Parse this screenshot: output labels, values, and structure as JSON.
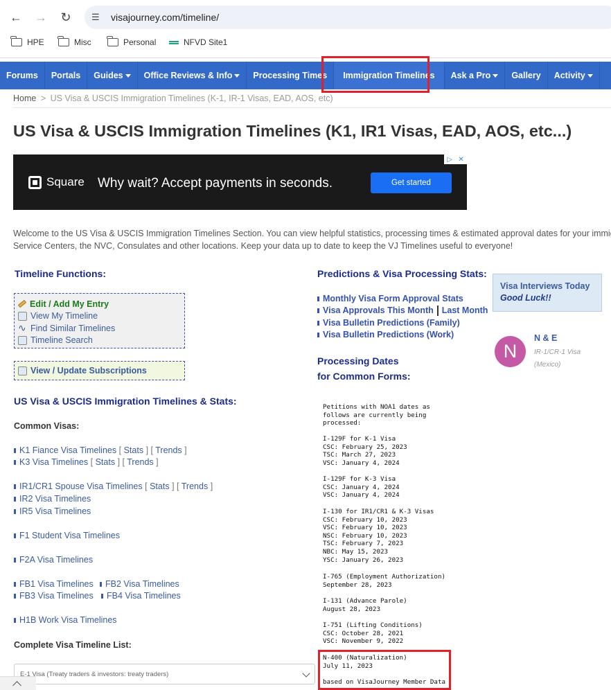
{
  "browser": {
    "url": "visajourney.com/timeline/",
    "bookmarks": [
      "HPE",
      "Misc",
      "Personal",
      "NFVD Site1"
    ]
  },
  "nav": {
    "items": [
      {
        "label": "Forums",
        "dropdown": false
      },
      {
        "label": "Portals",
        "dropdown": false
      },
      {
        "label": "Guides",
        "dropdown": true
      },
      {
        "label": "Office Reviews & Info",
        "dropdown": true
      },
      {
        "label": "Processing Times",
        "dropdown": false
      },
      {
        "label": "Immigration Timelines",
        "dropdown": false,
        "active": true
      },
      {
        "label": "Ask a Pro",
        "dropdown": true
      },
      {
        "label": "Gallery",
        "dropdown": false
      },
      {
        "label": "Activity",
        "dropdown": true
      }
    ],
    "color": "#3369c9",
    "highlight_color": "#e0202a"
  },
  "breadcrumb": {
    "home": "Home",
    "sep": ">",
    "current": "US Visa & USCIS Immigration Timelines (K-1, IR-1 Visas, EAD, AOS, etc)"
  },
  "page_title": "US Visa & USCIS Immigration Timelines (K1, IR1 Visas, EAD, AOS, etc...)",
  "ad": {
    "brand": "Square",
    "tagline": "Why wait? Accept payments in seconds.",
    "cta": "Get started"
  },
  "intro": [
    "Welcome to the US Visa & USCIS Immigration Timelines Section. You can view helpful statistics, processing times & estimated approval dates for your immigr",
    "Service Centers, the NVC, Consulates and other locations. Keep your data up to date to keep the VJ Timelines useful to everyone!"
  ],
  "timeline_functions": {
    "heading": "Timeline Functions:",
    "items": [
      "Edit / Add My Entry",
      "View My Timeline",
      "Find Similar Timelines",
      "Timeline Search"
    ],
    "subscriptions": "View / Update Subscriptions"
  },
  "stats_section": {
    "heading": "US Visa & USCIS Immigration Timelines & Stats:",
    "common_visas_label": "Common Visas:",
    "stats": "Stats",
    "trends": "Trends",
    "links": {
      "k1": "K1 Fiance Visa Timelines",
      "k3": "K3 Visa Timelines",
      "ir1": "IR1/CR1 Spouse Visa Timelines",
      "ir2": "IR2 Visa Timelines",
      "ir5": "IR5 Visa Timelines",
      "f1": "F1 Student Visa Timelines",
      "f2a": "F2A Visa Timelines",
      "fb1": "FB1 Visa Timelines",
      "fb2": "FB2 Visa Timelines",
      "fb3": "FB3 Visa Timelines",
      "fb4": "FB4 Visa Timelines",
      "h1b": "H1B Work Visa Timelines"
    },
    "complete_list_label": "Complete Visa Timeline List:",
    "select_value": "E-1 Visa (Treaty traders & investors: treaty traders)"
  },
  "predictions": {
    "heading": "Predictions & Visa Processing Stats:",
    "links": {
      "monthly": "Monthly Visa Form Approval Stats",
      "this_month": "Visa Approvals This Month",
      "last_month": "Last Month",
      "vb_family": "Visa Bulletin Predictions (Family)",
      "vb_work": "Visa Bulletin Predictions (Work)"
    }
  },
  "processing": {
    "heading1": "Processing Dates",
    "heading2": "for Common Forms:",
    "blocks": {
      "intro": "Petitions with NOA1 dates as\nfollows are currently being\nprocessed:",
      "i129f_k1": "I-129F for K-1 Visa\nCSC: February 25, 2023\nTSC: March 27, 2023\nVSC: January 4, 2024",
      "i129f_k3": "I-129F for K-3 Visa\nCSC: January 4, 2024\nVSC: January 4, 2024",
      "i130": "I-130 for IR1/CR1 & K-3 Visas\nCSC: February 10, 2023\nVSC: February 10, 2023\nNSC: February 10, 2023\nTSC: February 7, 2023\nNBC: May 15, 2023\nYSC: January 26, 2023",
      "i765": "I-765 (Employment Authorization)\nSeptember 28, 2023",
      "i131": "I-131 (Advance Parole)\nAugust 28, 2023",
      "i751": "I-751 (Lifting Conditions)\nCSC: October 28, 2021\nVSC: November 9, 2022",
      "n400": "N-400 (Naturalization)\nJuly 11, 2023",
      "footer": "based on VisaJourney Member Data"
    }
  },
  "interviews": {
    "title": "Visa Interviews Today",
    "subtitle": "Good Luck!!"
  },
  "member": {
    "initial": "N",
    "name": "N & E",
    "type": "IR-1/CR-1 Visa",
    "country": "(Mexico)",
    "avatar_color": "#c659a6"
  }
}
